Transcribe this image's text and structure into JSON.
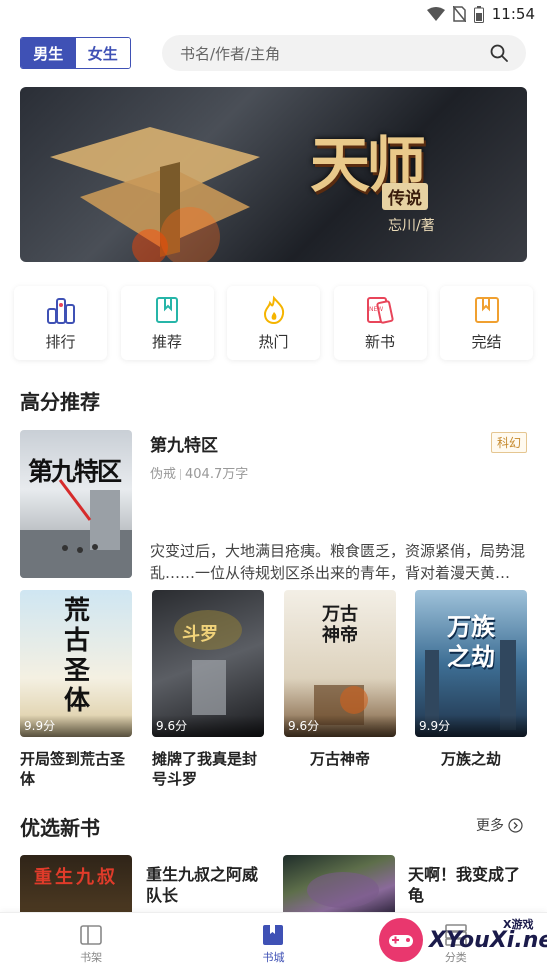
{
  "status_bar": {
    "time": "11:54"
  },
  "header": {
    "gender_tabs": [
      "男生",
      "女生"
    ],
    "active_gender": "男生",
    "search_placeholder": "书名/作者/主角"
  },
  "banner": {
    "title": "天师",
    "subtitle": "传说",
    "author": "忘川/著"
  },
  "quick_nav": [
    {
      "label": "排行",
      "icon": "ranking-icon"
    },
    {
      "label": "推荐",
      "icon": "bookmark-icon"
    },
    {
      "label": "热门",
      "icon": "flame-icon"
    },
    {
      "label": "新书",
      "icon": "new-book-icon"
    },
    {
      "label": "完结",
      "icon": "finished-book-icon"
    }
  ],
  "high_score": {
    "title": "高分推荐",
    "featured": {
      "title": "第九特区",
      "tag": "科幻",
      "author": "伪戒",
      "words": "404.7万字",
      "description": "灾变过后，大地满目疮痍。粮食匮乏，资源紧俏，局势混乱……一位从待规划区杀出来的青年，背对着漫天黄…",
      "cover_text": "第九特区"
    },
    "books": [
      {
        "title": "开局签到荒古圣体",
        "score": "9.9分",
        "cover_text": "荒古圣体"
      },
      {
        "title": "摊牌了我真是封号斗罗",
        "score": "9.6分",
        "cover_text": "斗罗"
      },
      {
        "title": "万古神帝",
        "score": "9.6分",
        "cover_text": "万古神帝"
      },
      {
        "title": "万族之劫",
        "score": "9.9分",
        "cover_text": "万族之劫"
      }
    ]
  },
  "new_books": {
    "title": "优选新书",
    "more": "更多",
    "items": [
      {
        "title": "重生九叔之阿威队长",
        "cover_text": "重生九叔"
      },
      {
        "title": "天啊！我变成了龟"
      }
    ]
  },
  "tab_bar": [
    {
      "label": "书架",
      "icon": "bookshelf-icon"
    },
    {
      "label": "书城",
      "icon": "bookstore-icon"
    },
    {
      "label": "分类",
      "icon": "category-icon"
    }
  ],
  "active_tab": "书城",
  "watermark": {
    "text": "XYouXi.net",
    "small": "X游戏"
  },
  "colors": {
    "accent": "#3f51b5",
    "tag": "#c68a2e"
  }
}
